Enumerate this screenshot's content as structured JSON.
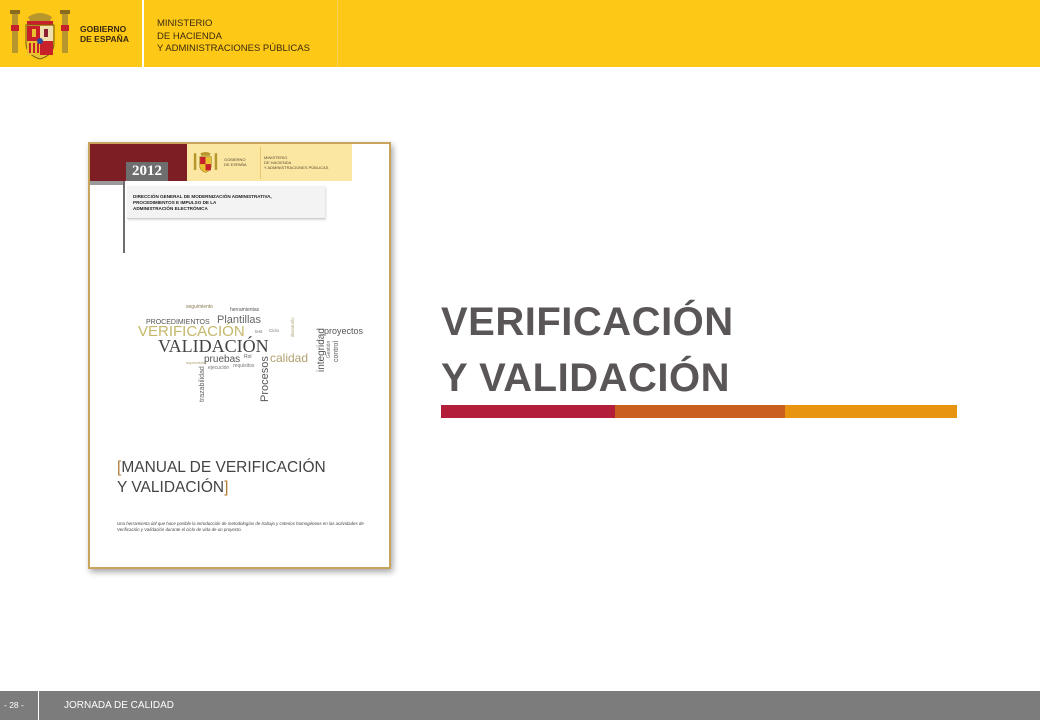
{
  "header": {
    "government": {
      "line1": "GOBIERNO",
      "line2": "DE ESPAÑA"
    },
    "ministry": {
      "line1": "MINISTERIO",
      "line2": "DE HACIENDA",
      "line3": "Y ADMINISTRACIONES PÚBLICAS"
    }
  },
  "document": {
    "year": "2012",
    "government": {
      "line1": "GOBIERNO",
      "line2": "DE ESPAÑA"
    },
    "ministry": {
      "line1": "MINISTERIO",
      "line2": "DE HACIENDA",
      "line3": "Y ADMINISTRACIONES PÚBLICAS"
    },
    "subtitle": {
      "line1": "DIRECCIÓN GENERAL DE MODERNIZACIÓN ADMINISTRATIVA,",
      "line2": "PROCEDIMIENTOS E IMPULSO DE LA",
      "line3": "ADMINISTRACIÓN ELECTRÓNICA"
    },
    "word_cloud": {
      "seguimiento": "seguimiento",
      "herramientas": "herramientas",
      "procedimientos": "PROCEDIMIENTOS",
      "plantillas": "Plantillas",
      "verificacion": "VERIFICACIÓN",
      "test": "test",
      "ciclo": "Ciclo",
      "validacion": "VALIDACIÓN",
      "pruebas": "pruebas",
      "rol": "Rol",
      "ejecucion": "ejecución",
      "requisitos": "requisitos",
      "calidad": "calidad",
      "procesos": "Procesos",
      "trazabilidad": "trazabilidad",
      "integridad": "integridad",
      "gestion": "Gestión",
      "control": "control",
      "proyectos": "proyectos",
      "desarrollo": "desarrollo",
      "supervision": "supervisión"
    },
    "title": {
      "open": "[",
      "line1": "MANUAL DE VERIFICACIÓN",
      "line2": "Y VALIDACIÓN",
      "close": "]"
    },
    "description": "Una herramienta útil que hace posible la introducción de metodologías de trabajo y criterios homogéneos en las actividades de Verificación y Validación durante el ciclo de vida de un proyecto."
  },
  "main": {
    "title_line1": "VERIFICACIÓN",
    "title_line2": "Y VALIDACIÓN",
    "accent_colors": [
      "#b31f3a",
      "#c95f1f",
      "#e89410"
    ]
  },
  "footer": {
    "page_number": "- 28 -",
    "label": "JORNADA DE CALIDAD"
  },
  "colors": {
    "header_bg": "#fdc816",
    "footer_bg": "#7c7c7c",
    "title_text": "#5a5658",
    "document_red": "#7d1e24"
  }
}
